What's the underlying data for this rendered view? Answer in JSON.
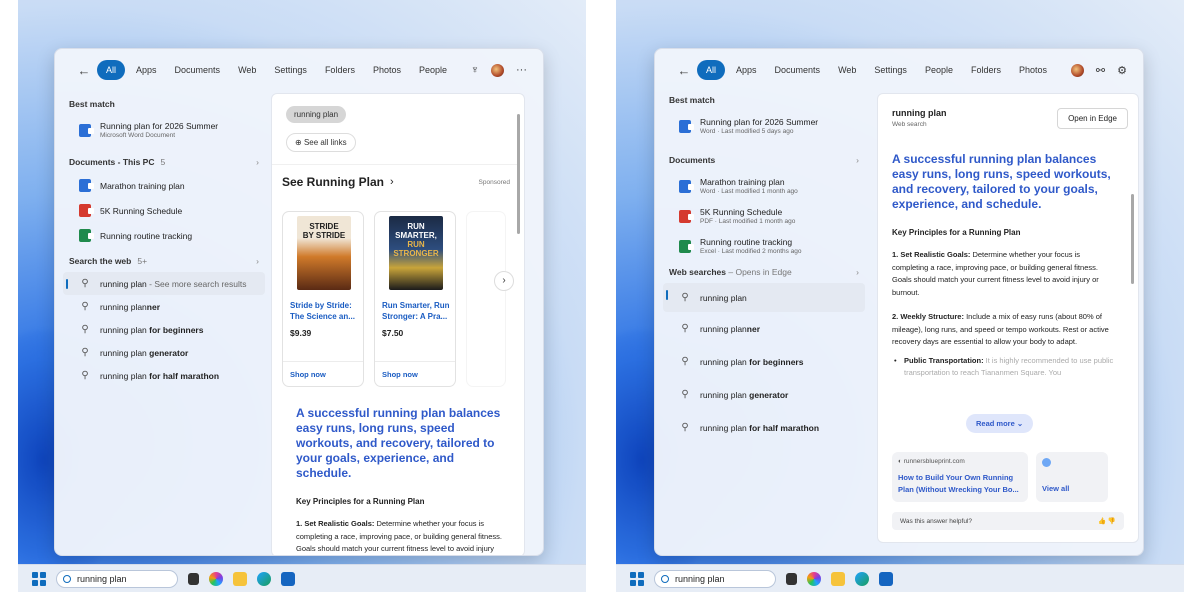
{
  "left": {
    "filters": [
      "All",
      "Apps",
      "Documents",
      "Web",
      "Settings",
      "Folders",
      "Photos",
      "People"
    ],
    "best_match_header": "Best match",
    "best_match": {
      "title": "Running plan for 2026 Summer",
      "subtitle": "Microsoft Word Document"
    },
    "documents_header": "Documents - This PC",
    "documents_count": "5",
    "documents": [
      {
        "title": "Marathon training plan",
        "type": "word"
      },
      {
        "title": "5K Running Schedule",
        "type": "pdf"
      },
      {
        "title": "Running routine tracking",
        "type": "xls"
      }
    ],
    "web_header": "Search the web",
    "web_count": "5+",
    "web_first": {
      "query": "running plan",
      "suffix": " - See more search results"
    },
    "web_suggestions": [
      {
        "base": "running plan",
        "bold": "ner"
      },
      {
        "base": "running plan",
        "bold": " for beginners"
      },
      {
        "base": "running plan",
        "bold": " generator"
      },
      {
        "base": "running plan",
        "bold": " for half marathon"
      }
    ],
    "preview": {
      "query_pill": "running plan",
      "see_all": "See all links",
      "section_title": "See Running Plan",
      "sponsored": "Sponsored",
      "books": [
        {
          "cover_line1": "STRIDE",
          "cover_line2": "BY STRIDE",
          "title": "Stride by Stride: The Science an...",
          "price": "$9.39",
          "shop": "Shop now"
        },
        {
          "cover_line1": "RUN SMARTER,",
          "cover_line2": "RUN STRONGER",
          "title": "Run Smarter, Run Stronger: A Pra...",
          "price": "$7.50",
          "shop": "Shop now"
        }
      ],
      "answer": "A successful running plan balances easy runs, long runs, speed workouts, and recovery, tailored to your goals, experience, and schedule.",
      "key_principles": "Key Principles for a Running Plan",
      "point1_label": "1. Set Realistic Goals:",
      "point1_text": " Determine whether your focus is completing a race, improving pace, or building general fitness. Goals should match your current fitness level to avoid injury or burnout."
    },
    "taskbar_search": "running plan"
  },
  "right": {
    "filters": [
      "All",
      "Apps",
      "Documents",
      "Web",
      "Settings",
      "People",
      "Folders",
      "Photos"
    ],
    "best_match_header": "Best match",
    "best_match": {
      "title": "Running plan for 2026 Summer",
      "subtitle": "Word · Last modified 5 days ago"
    },
    "documents_header": "Documents",
    "documents": [
      {
        "title": "Marathon training plan",
        "subtitle": "Word · Last modified 1 month ago",
        "type": "word"
      },
      {
        "title": "5K Running Schedule",
        "subtitle": "PDF · Last modified 1 month ago",
        "type": "pdf"
      },
      {
        "title": "Running routine tracking",
        "subtitle": "Excel · Last modified 2 months ago",
        "type": "xls"
      }
    ],
    "web_header": "Web searches",
    "web_header_suffix": " – Opens in Edge",
    "web_first": "running plan",
    "web_suggestions": [
      {
        "base": "running plan",
        "bold": "ner"
      },
      {
        "base": "running plan",
        "bold": " for beginners"
      },
      {
        "base": "running plan",
        "bold": " generator"
      },
      {
        "base": "running plan",
        "bold": " for half marathon"
      }
    ],
    "preview": {
      "title": "running plan",
      "subtitle": "Web search",
      "open_in_edge": "Open in Edge",
      "answer": "A successful running plan balances easy runs, long runs, speed workouts, and recovery, tailored to your goals, experience, and schedule.",
      "key_principles": "Key Principles for a Running Plan",
      "point1_label": "1. Set Realistic Goals:",
      "point1_text": " Determine whether your focus is completing a race, improving pace, or building general fitness. Goals should match your current fitness level to avoid injury or burnout.",
      "point2_label": "2. Weekly Structure:",
      "point2_text": " Include a mix of easy runs (about 80% of mileage), long runs, and speed or tempo workouts. Rest or active recovery days are essential to allow your body to adapt.",
      "bullet_label": "Public Transportation:",
      "bullet_text": " It is highly recommended to use public transportation to reach Tiananmen Square. You",
      "read_more": "Read more",
      "link_source": "runnersblueprint.com",
      "link_title": "How to Build Your Own Running Plan (Without Wrecking Your Bo...",
      "view_all": "View all",
      "helpful": "Was this answer helpful?"
    },
    "taskbar_search": "running plan"
  }
}
